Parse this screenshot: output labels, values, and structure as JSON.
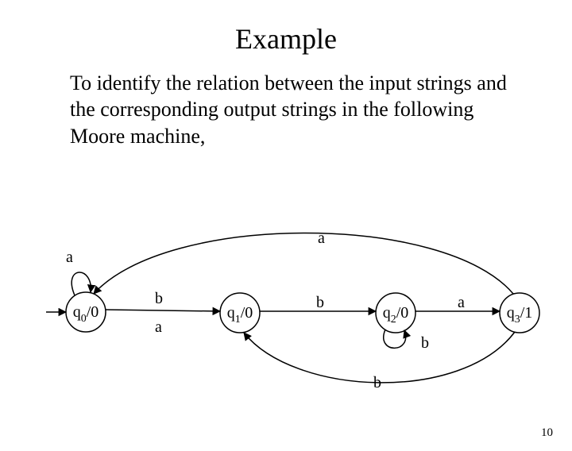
{
  "title": "Example",
  "paragraph": "To identify the relation between the input strings and the corresponding output strings in the following Moore machine,",
  "page_number": "10",
  "diagram": {
    "states": {
      "q0": {
        "q": "q",
        "sub": "0",
        "out": "/0"
      },
      "q1": {
        "q": "q",
        "sub": "1",
        "out": "/0"
      },
      "q2": {
        "q": "q",
        "sub": "2",
        "out": "/0"
      },
      "q3": {
        "q": "q",
        "sub": "3",
        "out": "/1"
      }
    },
    "labels": {
      "loop_a": "a",
      "top_a": "a",
      "b_top": "b",
      "a_mid": "a",
      "b_mid": "b",
      "a_right": "a",
      "b_loop": "b",
      "b_bottom": "b"
    }
  }
}
